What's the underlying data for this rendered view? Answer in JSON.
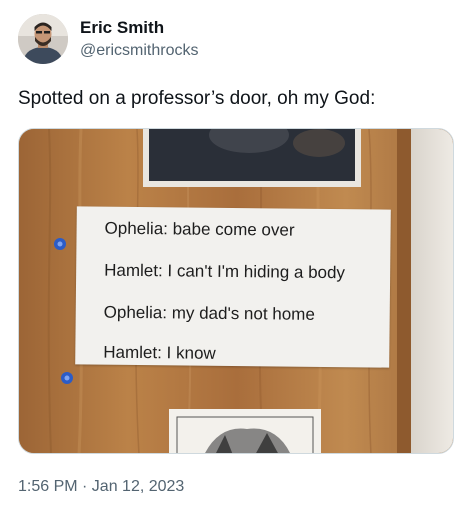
{
  "author": {
    "display_name": "Eric Smith",
    "handle": "@ericsmithrocks"
  },
  "tweet": {
    "text": "Spotted on a professor’s door, oh my God:",
    "timestamp": "1:56 PM · Jan 12, 2023"
  },
  "photo": {
    "note_lines": [
      "Ophelia: babe come over",
      "Hamlet: I can't I'm hiding a body",
      "Ophelia: my dad's not home",
      "Hamlet: I know"
    ]
  },
  "colors": {
    "text_primary": "#0f1419",
    "text_secondary": "#536471",
    "door_wood": "#b47a45",
    "pin_blue": "#2b5cc7"
  }
}
